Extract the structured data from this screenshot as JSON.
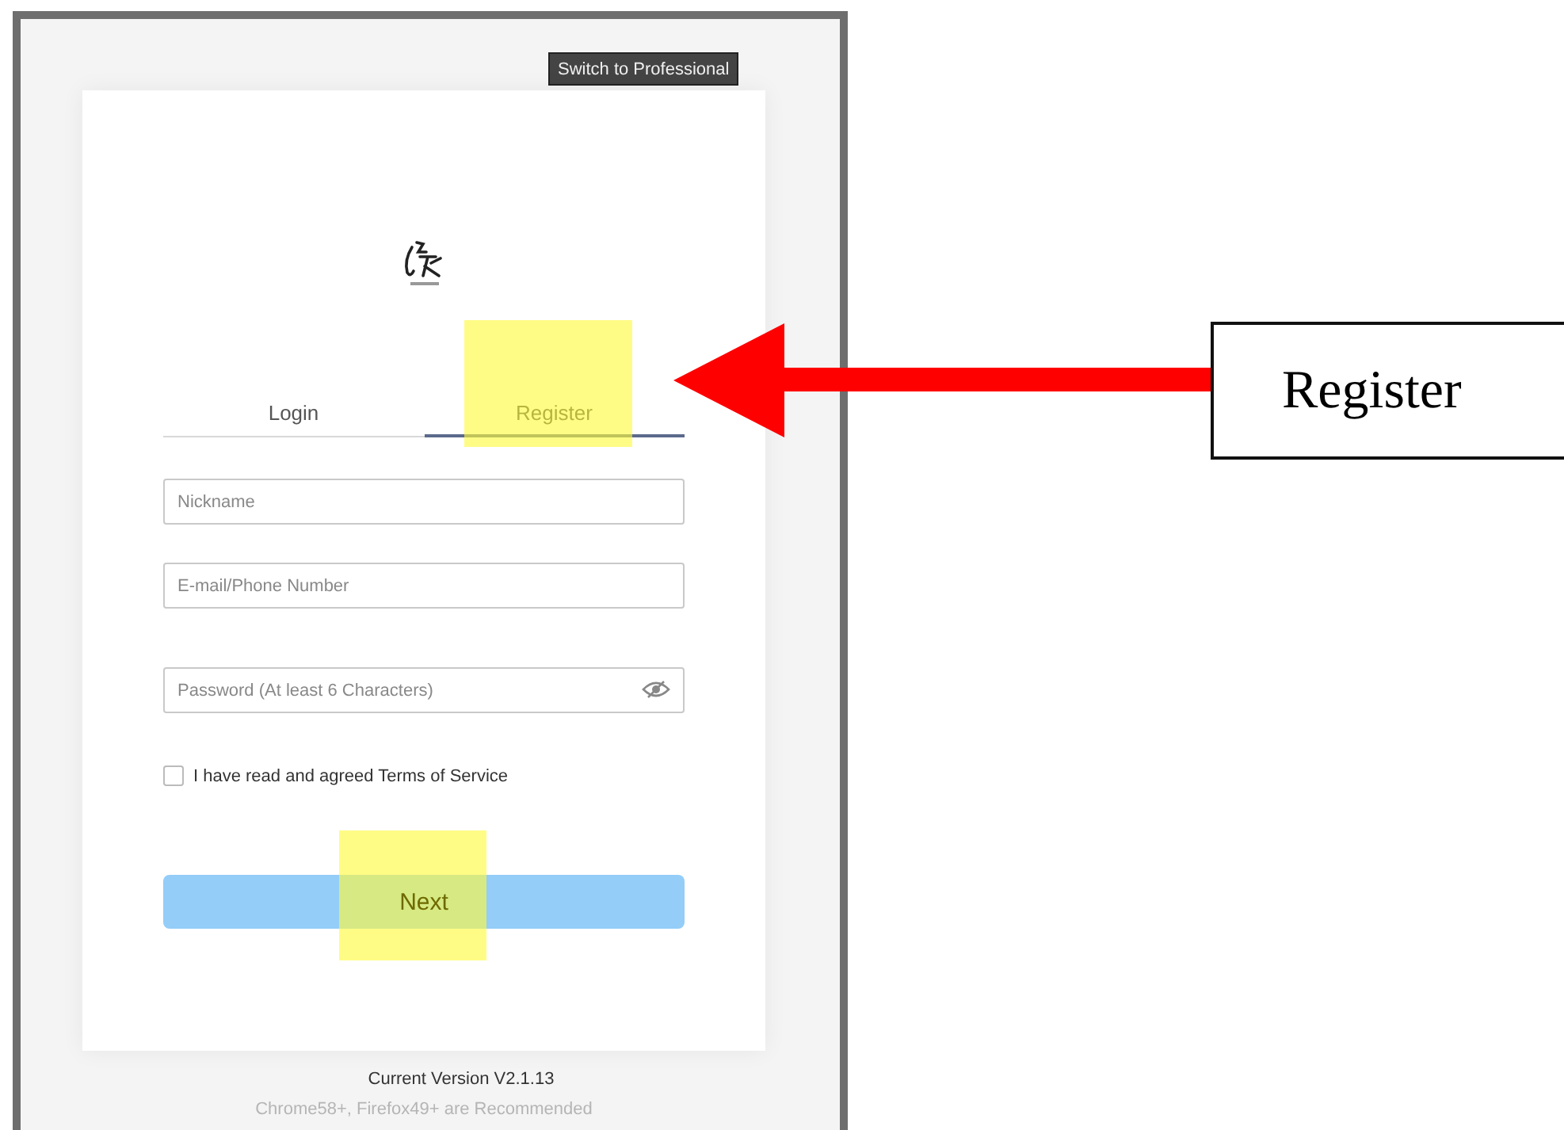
{
  "switch_button": "Switch to Professional",
  "tabs": [
    {
      "label": "Login",
      "selected": false,
      "highlighted": false
    },
    {
      "label": "Register",
      "selected": true,
      "highlighted": true
    }
  ],
  "fields": [
    {
      "placeholder": "Nickname",
      "kind": "text"
    },
    {
      "placeholder": "E-mail/Phone Number",
      "kind": "text"
    },
    {
      "placeholder": "Password (At least 6 Characters)",
      "kind": "password"
    }
  ],
  "terms": {
    "label": "I have read and agreed Terms of Service",
    "checked": false
  },
  "next_button": {
    "label": "Next",
    "highlighted": true
  },
  "footer": {
    "version": "Current Version V2.1.13",
    "browsers": "Chrome58+, Firefox49+ are Recommended"
  },
  "callout": {
    "label": "Register"
  }
}
